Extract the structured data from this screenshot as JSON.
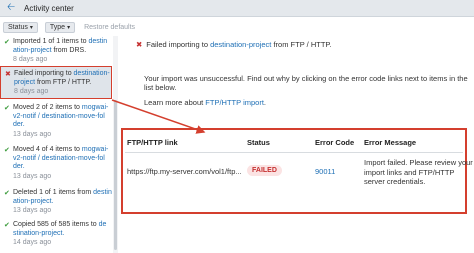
{
  "header": {
    "title": "Activity center",
    "back_icon": "arrow-left-icon"
  },
  "filters": {
    "status_label": "Status",
    "type_label": "Type",
    "restore_label": "Restore defaults"
  },
  "activities": [
    {
      "status": "ok",
      "line1_prefix": "Imported 1 of 1 items to ",
      "line1_link": "destin",
      "line2_link": "ation-project",
      "line2_suffix": " from DRS.",
      "time": "8 days ago"
    },
    {
      "status": "error",
      "line1_prefix": "Failed importing to ",
      "line1_link": "destination-",
      "line2_link": "project",
      "line2_suffix": " from FTP / HTTP.",
      "time": "8 days ago"
    },
    {
      "status": "ok",
      "line1_prefix": "Moved 2 of 2 items to ",
      "line1_link": "mogwai-",
      "line2_link": "v2-notif / destination-move-fol",
      "line3_link": "der.",
      "time": "13 days ago"
    },
    {
      "status": "ok",
      "line1_prefix": "Moved 4 of 4 items to ",
      "line1_link": "mogwai-",
      "line2_link": "v2-notif / destination-move-fol",
      "line3_link": "der.",
      "time": "13 days ago"
    },
    {
      "status": "ok",
      "line1_prefix": "Deleted 1 of 1 items from ",
      "line1_link": "destin",
      "line2_link": "ation-project.",
      "time": "13 days ago"
    },
    {
      "status": "ok",
      "line1_prefix": "Copied 585 of 585 items to ",
      "line1_link": "de",
      "line2_link": "stination-project.",
      "time": "14 days ago"
    }
  ],
  "detail": {
    "head_prefix": "Failed importing to ",
    "head_link": "destination-project",
    "head_suffix": " from FTP / HTTP.",
    "message": "Your import was unsuccessful. Find out why by clicking on the error code links next to items in the list below.",
    "learn_prefix": "Learn more about ",
    "learn_link": "FTP/HTTP import",
    "learn_suffix": "."
  },
  "table": {
    "headers": [
      "FTP/HTTP link",
      "Status",
      "Error Code",
      "Error Message"
    ],
    "rows": [
      {
        "link": "https://ftp.my-server.com/vol1/ftp...",
        "status": "FAILED",
        "code": "90011",
        "message": "Import failed. Please review your import links and FTP/HTTP server credentials."
      }
    ]
  },
  "colors": {
    "accent": "#1e6fb5",
    "error": "#c53030",
    "success": "#3d9c3d",
    "highlight": "#d43f2e"
  }
}
